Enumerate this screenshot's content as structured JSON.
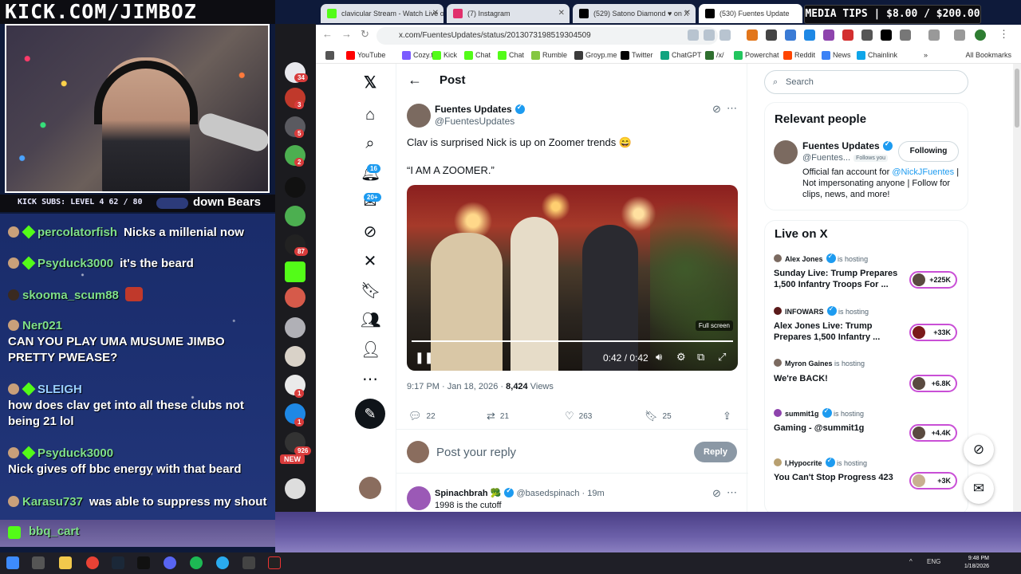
{
  "overlay": {
    "banner": "KICK.COM/JIMBOZ",
    "subs_label": "KICK SUBS: LEVEL 4 62 / 80",
    "ticker": "down Bears",
    "media_tips": "MEDIA TIPS | $8.00 / $200.00"
  },
  "chat": {
    "messages": [
      {
        "user": "percolatorfish",
        "text": "Nicks a millenial now"
      },
      {
        "user": "Psyduck3000",
        "text": "it's the beard"
      },
      {
        "user": "skooma_scum88",
        "text": ""
      },
      {
        "user": "Ner021",
        "text": "CAN YOU PLAY UMA MUSUME JIMBO PRETTY PWEASE?"
      },
      {
        "user": "SLEIGH",
        "text": "how does clav get into all these clubs not being 21 lol"
      },
      {
        "user": "Psyduck3000",
        "text": "Nick gives off bbc energy with that beard"
      },
      {
        "user": "Karasu737",
        "text": "was able to suppress my shout"
      }
    ],
    "bottom_user": "bbq_cart"
  },
  "tabcol": {
    "badges": [
      "34",
      "3",
      "5",
      "2",
      "87",
      "1",
      "1",
      "926"
    ],
    "new_label": "NEW"
  },
  "browser": {
    "tabs": [
      {
        "title": "clavicular Stream - Watch Live o",
        "color": "#53fc18"
      },
      {
        "title": "(7) Instagram",
        "color": "#e1306c"
      },
      {
        "title": "(529) Satono Diamond ♥ on X",
        "color": "#000000"
      },
      {
        "title": "(530) Fuentes Update",
        "color": "#000000"
      }
    ],
    "url": "x.com/FuentesUpdates/status/2013073198519304509",
    "bookmarks": [
      {
        "label": "YouTube",
        "color": "#ff0000"
      },
      {
        "label": "Cozy.tv",
        "color": "#7b5cff"
      },
      {
        "label": "Kick",
        "color": "#53fc18"
      },
      {
        "label": "Chat",
        "color": "#53fc18"
      },
      {
        "label": "Chat",
        "color": "#53fc18"
      },
      {
        "label": "Rumble",
        "color": "#85c742"
      },
      {
        "label": "Groyp.me",
        "color": "#3b3b3b"
      },
      {
        "label": "Twitter",
        "color": "#000000"
      },
      {
        "label": "ChatGPT",
        "color": "#10a37f"
      },
      {
        "label": "/x/",
        "color": "#2f6f2f"
      },
      {
        "label": "Powerchat",
        "color": "#22c55e"
      },
      {
        "label": "Reddit",
        "color": "#ff4500"
      },
      {
        "label": "News",
        "color": "#3b82f6"
      },
      {
        "label": "Chainlink",
        "color": "#0ea5e9"
      }
    ],
    "all_bookmarks": "All Bookmarks"
  },
  "x": {
    "page_title": "Post",
    "badge_notifications": "16",
    "badge_messages": "20+",
    "post": {
      "author": "Fuentes Updates",
      "handle": "@FuentesUpdates",
      "text1": "Clav is surprised Nick is up on Zoomer trends 😄",
      "text2": "“I AM A ZOOMER.”",
      "video": {
        "time": "0:42 / 0:42",
        "tooltip": "Full screen",
        "progress": 1.0
      },
      "meta_time": "9:17 PM · Jan 18, 2026 ·",
      "views": "8,424",
      "views_label": "Views",
      "replies": "22",
      "reposts": "21",
      "likes": "263",
      "bookmarks": "25"
    },
    "reply_placeholder": "Post your reply",
    "reply_button": "Reply",
    "reply": {
      "author": "Spinachbrah 🥦",
      "handle": "@basedspinach · 19m",
      "text": "1998 is the cutoff"
    },
    "search_placeholder": "Search",
    "relevant": {
      "title": "Relevant people",
      "name": "Fuentes Updates",
      "handle": "@Fuentes...",
      "follows_you": "Follows you",
      "follow_label": "Following",
      "bio_pre": "Official fan account for",
      "bio_link": "@NickJFuentes",
      "bio_post": "| Not impersonating anyone | Follow for clips, news, and more!"
    },
    "live": {
      "title": "Live on X",
      "hosting_label": "is hosting",
      "items": [
        {
          "host": "Alex Jones",
          "title": "Sunday Live: Trump Prepares 1,500 Infantry Troops For ...",
          "count": "+225K"
        },
        {
          "host": "INFOWARS",
          "title": "Alex Jones Live: Trump Prepares 1,500 Infantry ...",
          "count": "+33K"
        },
        {
          "host": "Myron Gaines",
          "title": "We're BACK!",
          "count": "+6.8K"
        },
        {
          "host": "summit1g",
          "title": "Gaming - @summit1g",
          "count": "+4.4K"
        },
        {
          "host": "I,Hypocrite",
          "title": "You Can't Stop Progress 423",
          "count": "+3K"
        }
      ]
    }
  },
  "taskbar": {
    "lang": "ENG",
    "time": "9:48 PM",
    "date": "1/18/2026"
  }
}
